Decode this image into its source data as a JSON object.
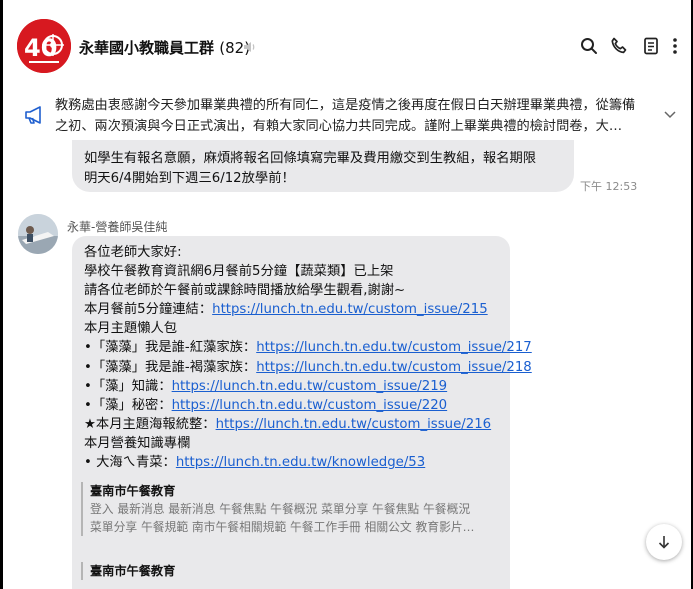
{
  "header": {
    "group_name": "永華國小教職員工群",
    "member_count": "(82)",
    "avatar_text": "40",
    "icons": [
      "search-icon",
      "phone-icon",
      "notes-icon",
      "more-vertical-icon",
      "mute-icon"
    ]
  },
  "announcement": {
    "text": "教務處由衷感謝今天參加畢業典禮的所有同仁，這是疫情之後再度在假日白天辦理畢業典禮，從籌備之初、兩次預演與今日正式演出，有賴大家同心協力共同完成。謹附上畢業典禮的檢討問卷，大…",
    "icon": "megaphone-icon"
  },
  "previous_message": {
    "lines": [
      "如學生有報名意願，麻煩將報名回條填寫完畢及費用繳交到生教組，報名期限",
      "明天6/4開始到下週三6/12放學前！"
    ],
    "time": "下午 12:53"
  },
  "message": {
    "sender": "永華-營養師吳佳純",
    "lines": [
      {
        "text": "各位老師大家好:",
        "link": ""
      },
      {
        "text": "學校午餐教育資訊網6月餐前5分鐘【蔬菜類】已上架",
        "link": ""
      },
      {
        "text": "請各位老師於午餐前或課餘時間播放給學生觀看,謝謝~",
        "link": ""
      },
      {
        "text": "本月餐前5分鐘連結：",
        "link": "https://lunch.tn.edu.tw/custom_issue/215"
      },
      {
        "text": "本月主題懶人包",
        "link": ""
      },
      {
        "text": "•「藻藻」我是誰-紅藻家族：",
        "link": "https://lunch.tn.edu.tw/custom_issue/217"
      },
      {
        "text": "•「藻藻」我是誰-褐藻家族：",
        "link": "https://lunch.tn.edu.tw/custom_issue/218"
      },
      {
        "text": "•「藻」知識：",
        "link": "https://lunch.tn.edu.tw/custom_issue/219"
      },
      {
        "text": "•「藻」秘密：",
        "link": "https://lunch.tn.edu.tw/custom_issue/220"
      },
      {
        "text": "★本月主題海報統整：",
        "link": "https://lunch.tn.edu.tw/custom_issue/216"
      },
      {
        "text": "本月營養知識專欄",
        "link": ""
      },
      {
        "text": "• 大海ㄟ青菜：",
        "link": "https://lunch.tn.edu.tw/knowledge/53"
      }
    ],
    "preview1": {
      "title": "臺南市午餐教育",
      "desc_line1": "登入 最新消息 最新消息 午餐焦點 午餐概況 菜單分享 午餐焦點 午餐概況",
      "desc_line2": "菜單分享 午餐規範 南市午餐相關規範 午餐工作手冊 相關公文 教育影片…"
    },
    "preview2": {
      "title": "臺南市午餐教育"
    }
  }
}
